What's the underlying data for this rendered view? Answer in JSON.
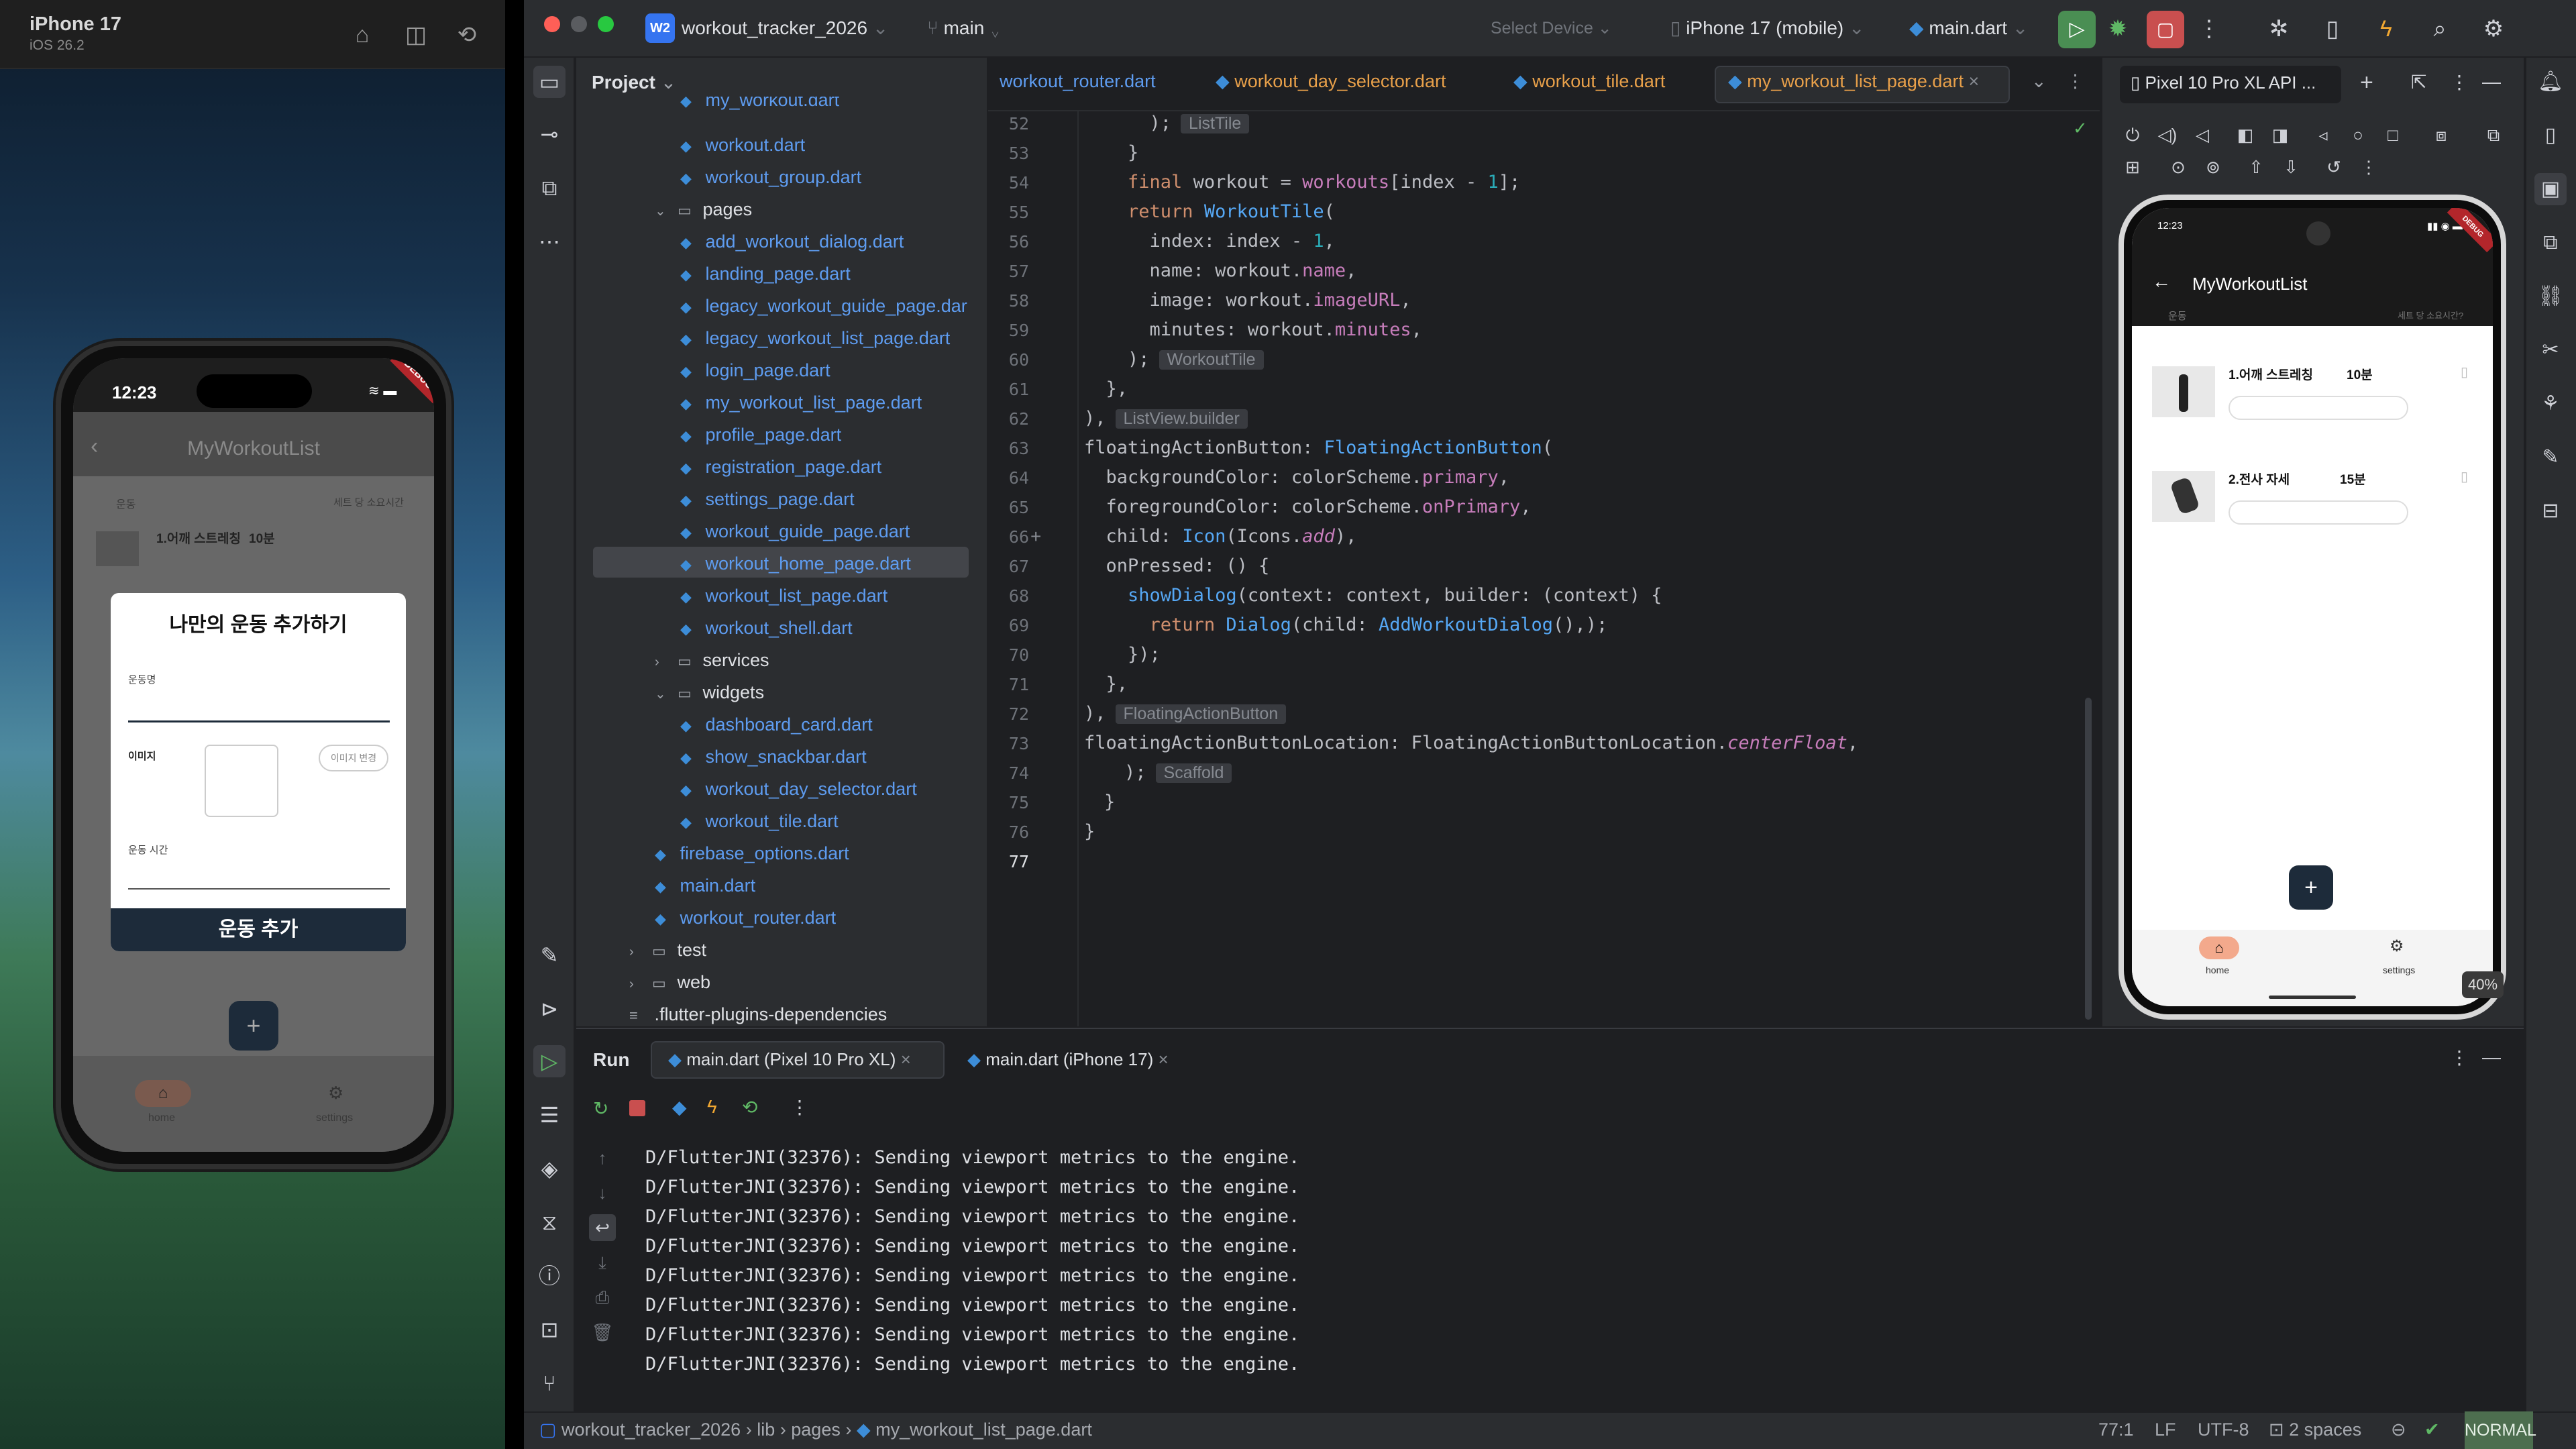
{
  "simulator": {
    "device": "iPhone 17",
    "os": "iOS 26.2",
    "time": "12:23",
    "debug": "DEBUG",
    "app_title": "MyWorkoutList",
    "col_left": "운동",
    "col_right": "세트 당 소요시간",
    "row1_name": "1.어깨 스트레칭",
    "row1_min": "10분",
    "dialog": {
      "title": "나만의 운동 추가하기",
      "name_label": "운동명",
      "image_label": "이미지",
      "image_button": "이미지 변경",
      "time_label": "운동 시간",
      "submit": "운동 추가"
    },
    "fab": "+",
    "nav_home": "home",
    "nav_settings": "settings"
  },
  "topbar": {
    "project_badge": "W2",
    "project": "workout_tracker_2026",
    "branch": "main",
    "select_device": "Select Device",
    "device": "iPhone 17 (mobile)",
    "config": "main.dart"
  },
  "project_panel": {
    "title": "Project",
    "items": [
      {
        "label": "my_workout.dart",
        "type": "file",
        "indent": 3
      },
      {
        "label": "workout.dart",
        "type": "file",
        "indent": 3
      },
      {
        "label": "workout_group.dart",
        "type": "file",
        "indent": 3
      },
      {
        "label": "pages",
        "type": "folder-open",
        "indent": 2
      },
      {
        "label": "add_workout_dialog.dart",
        "type": "file",
        "indent": 3
      },
      {
        "label": "landing_page.dart",
        "type": "file",
        "indent": 3
      },
      {
        "label": "legacy_workout_guide_page.dar",
        "type": "file",
        "indent": 3
      },
      {
        "label": "legacy_workout_list_page.dart",
        "type": "file",
        "indent": 3
      },
      {
        "label": "login_page.dart",
        "type": "file",
        "indent": 3
      },
      {
        "label": "my_workout_list_page.dart",
        "type": "file",
        "indent": 3
      },
      {
        "label": "profile_page.dart",
        "type": "file",
        "indent": 3
      },
      {
        "label": "registration_page.dart",
        "type": "file",
        "indent": 3
      },
      {
        "label": "settings_page.dart",
        "type": "file",
        "indent": 3
      },
      {
        "label": "workout_guide_page.dart",
        "type": "file",
        "indent": 3
      },
      {
        "label": "workout_home_page.dart",
        "type": "file",
        "indent": 3
      },
      {
        "label": "workout_list_page.dart",
        "type": "file",
        "indent": 3
      },
      {
        "label": "workout_shell.dart",
        "type": "file",
        "indent": 3
      },
      {
        "label": "services",
        "type": "folder",
        "indent": 2
      },
      {
        "label": "widgets",
        "type": "folder-open",
        "indent": 2
      },
      {
        "label": "dashboard_card.dart",
        "type": "file",
        "indent": 3
      },
      {
        "label": "show_snackbar.dart",
        "type": "file",
        "indent": 3
      },
      {
        "label": "workout_day_selector.dart",
        "type": "file",
        "indent": 3
      },
      {
        "label": "workout_tile.dart",
        "type": "file",
        "indent": 3
      },
      {
        "label": "firebase_options.dart",
        "type": "file",
        "indent": 2
      },
      {
        "label": "main.dart",
        "type": "file",
        "indent": 2
      },
      {
        "label": "workout_router.dart",
        "type": "file",
        "indent": 2
      },
      {
        "label": "test",
        "type": "folder",
        "indent": 1
      },
      {
        "label": "web",
        "type": "folder",
        "indent": 1
      },
      {
        "label": ".flutter-plugins-dependencies",
        "type": "plain",
        "indent": 1
      }
    ]
  },
  "tabs": [
    "workout_router.dart",
    "workout_day_selector.dart",
    "workout_tile.dart",
    "my_workout_list_page.dart"
  ],
  "code": {
    "line_numbers": [
      "52",
      "53",
      "54",
      "55",
      "56",
      "57",
      "58",
      "59",
      "60",
      "61",
      "62",
      "63",
      "64",
      "65",
      "66",
      "67",
      "68",
      "69",
      "70",
      "71",
      "72",
      "73",
      "74",
      "75",
      "76",
      "77"
    ],
    "hints": [
      "ListTile",
      "WorkoutTile",
      "ListView.builder",
      "FloatingActionButton",
      "Scaffold"
    ]
  },
  "emulator": {
    "tab": "Pixel 10 Pro XL API ...",
    "time": "12:23",
    "debug": "DEBUG",
    "app_title": "MyWorkoutList",
    "col_left": "운동",
    "col_right": "세트 당 소요시간?",
    "row1_name": "1.어깨 스트레칭",
    "row1_min": "10분",
    "row2_name": "2.전사 자세",
    "row2_min": "15분",
    "fab": "+",
    "nav_home": "home",
    "nav_settings": "settings",
    "zoom": "40%"
  },
  "run_panel": {
    "title": "Run",
    "tab1": "main.dart (Pixel 10 Pro XL)",
    "tab2": "main.dart (iPhone 17)",
    "log_line": "D/FlutterJNI(32376): Sending viewport metrics to the engine.",
    "log_count": 8
  },
  "statusbar": {
    "crumbs": [
      "workout_tracker_2026",
      "lib",
      "pages",
      "my_workout_list_page.dart"
    ],
    "position": "77:1",
    "line_sep": "LF",
    "encoding": "UTF-8",
    "indent": "2 spaces",
    "mode": "NORMAL"
  }
}
